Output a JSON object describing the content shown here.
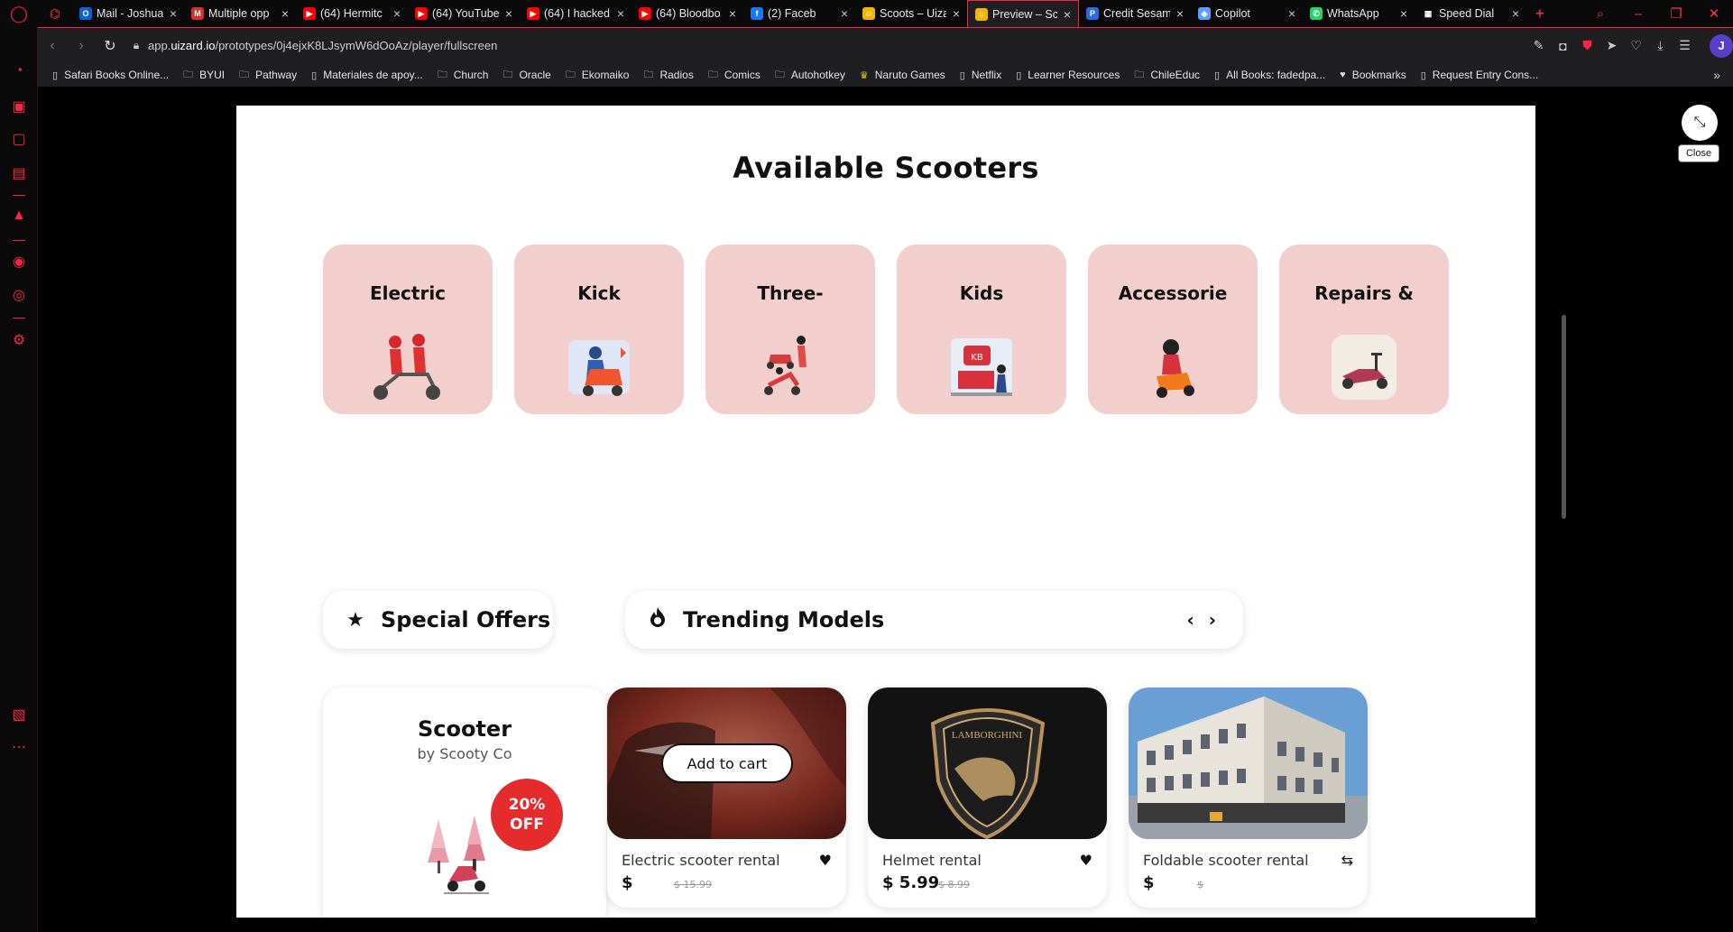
{
  "tabs": [
    {
      "title": "Mail - Joshua",
      "fav_color": "#0a64d6",
      "fav_glyph": "O",
      "active": false
    },
    {
      "title": "Multiple opp",
      "fav_color": "#d93025",
      "fav_glyph": "M",
      "active": false
    },
    {
      "title": "(64) Hermitc",
      "fav_color": "#ff0000",
      "fav_glyph": "▶",
      "active": false
    },
    {
      "title": "(64) YouTube",
      "fav_color": "#ff0000",
      "fav_glyph": "▶",
      "active": false
    },
    {
      "title": "(64) I hacked",
      "fav_color": "#ff0000",
      "fav_glyph": "▶",
      "active": false
    },
    {
      "title": "(64) Bloodbo",
      "fav_color": "#ff0000",
      "fav_glyph": "▶",
      "active": false
    },
    {
      "title": "(2) Faceb",
      "fav_color": "#1877f2",
      "fav_glyph": "f",
      "active": false
    },
    {
      "title": "Scoots – Uiza",
      "fav_color": "#f5b400",
      "fav_glyph": "☺",
      "active": false
    },
    {
      "title": "Preview – Sco",
      "fav_color": "#f5b400",
      "fav_glyph": "☺",
      "active": true
    },
    {
      "title": "Credit Sesam",
      "fav_color": "#2c6bd8",
      "fav_glyph": "P",
      "active": false
    },
    {
      "title": "Copilot",
      "fav_color": "#5aa0ff",
      "fav_glyph": "◆",
      "active": false
    },
    {
      "title": "WhatsApp",
      "fav_color": "#25d366",
      "fav_glyph": "✆",
      "active": false
    },
    {
      "title": "Speed Dial",
      "fav_color": "#0a0a0b",
      "fav_glyph": "▦",
      "active": false
    }
  ],
  "address": {
    "url_prefix": "app.",
    "url_domain": "uizard.io",
    "url_path": "/prototypes/0j4ejxK8LJsymW6dOoAz/player/fullscreen"
  },
  "bookmarks": [
    {
      "label": "Safari Books Online...",
      "icon": "page"
    },
    {
      "label": "BYUI",
      "icon": "folder"
    },
    {
      "label": "Pathway",
      "icon": "folder"
    },
    {
      "label": "Materiales de apoy...",
      "icon": "page"
    },
    {
      "label": "Church",
      "icon": "folder"
    },
    {
      "label": "Oracle",
      "icon": "folder"
    },
    {
      "label": "Ekomaiko",
      "icon": "folder"
    },
    {
      "label": "Radios",
      "icon": "folder"
    },
    {
      "label": "Comics",
      "icon": "folder"
    },
    {
      "label": "Autohotkey",
      "icon": "folder"
    },
    {
      "label": "Naruto Games",
      "icon": "crown"
    },
    {
      "label": "Netflix",
      "icon": "page"
    },
    {
      "label": "Learner Resources",
      "icon": "page"
    },
    {
      "label": "ChileEduc",
      "icon": "folder"
    },
    {
      "label": "All Books: fadedpa...",
      "icon": "page"
    },
    {
      "label": "Bookmarks",
      "icon": "heart"
    },
    {
      "label": "Request Entry Cons...",
      "icon": "page"
    }
  ],
  "page": {
    "title": "Available Scooters",
    "categories": [
      "Electric",
      "Kick",
      "Three-",
      "Kids",
      "Accessorie",
      "Repairs &"
    ],
    "special_offers_label": "Special Offers",
    "trending_label": "Trending Models",
    "offer": {
      "title": "Scooter",
      "subtitle": "by Scooty Co",
      "badge_line1": "20%",
      "badge_line2": "OFF"
    },
    "products": [
      {
        "name": "Electric scooter rental",
        "price": "$",
        "old_price": "$ 15.99",
        "add_to_cart": "Add to cart"
      },
      {
        "name": "Helmet rental",
        "price": "$ 5.99",
        "old_price": "$ 8.99"
      },
      {
        "name": "Foldable scooter rental",
        "price": "$",
        "old_price": "$"
      }
    ]
  },
  "overlay": {
    "close_tooltip": "Close"
  },
  "profile_initial": "J",
  "colors": {
    "accent": "#ff2244",
    "category_bg": "#f2cfcd",
    "badge": "#e52b2b"
  }
}
